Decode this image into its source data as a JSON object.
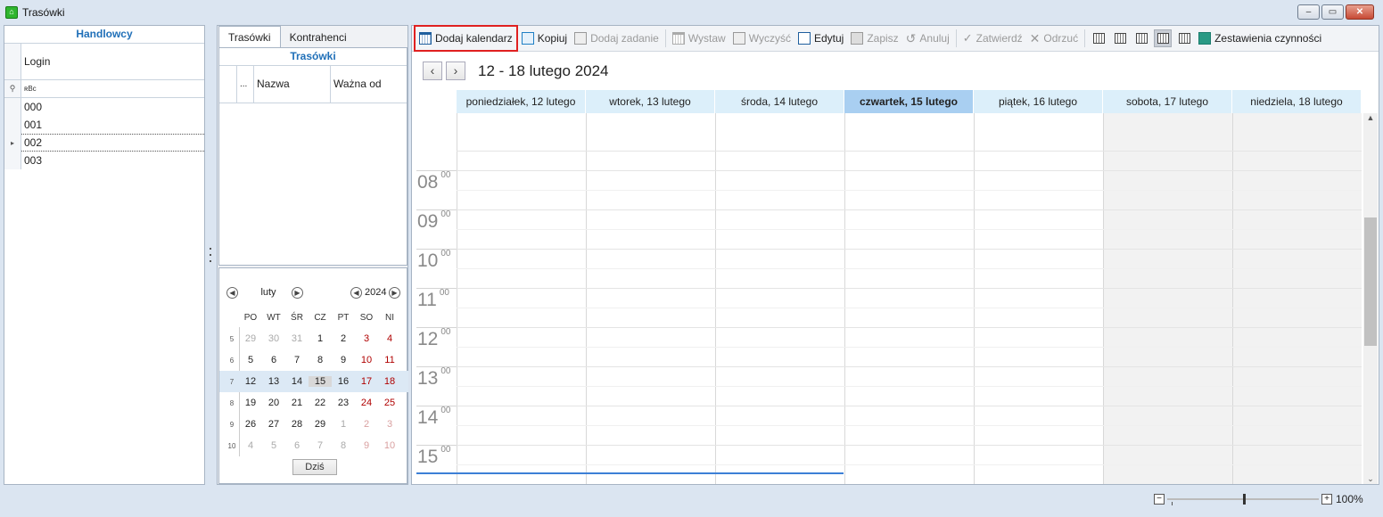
{
  "window": {
    "title": "Trasówki",
    "minimize": "‒",
    "maximize": "▭",
    "close": "✕"
  },
  "left": {
    "header": "Handlowcy",
    "column_login": "Login",
    "filter_abc": "ʀBc",
    "rows": [
      "000",
      "001",
      "002",
      "003"
    ],
    "selected_row": "002"
  },
  "middle": {
    "tabs": [
      "Trasówki",
      "Kontrahenci"
    ],
    "trasowki_header": "Trasówki",
    "columns": [
      "...",
      "Nazwa",
      "Ważna od"
    ],
    "calendar": {
      "month": "luty",
      "year": "2024",
      "weekday_heads": [
        "PO",
        "WT",
        "ŚR",
        "CZ",
        "PT",
        "SO",
        "NI"
      ],
      "weeks": [
        {
          "no": "5",
          "days": [
            "29",
            "30",
            "31",
            "1",
            "2",
            "3",
            "4"
          ]
        },
        {
          "no": "6",
          "days": [
            "5",
            "6",
            "7",
            "8",
            "9",
            "10",
            "11"
          ]
        },
        {
          "no": "7",
          "days": [
            "12",
            "13",
            "14",
            "15",
            "16",
            "17",
            "18"
          ]
        },
        {
          "no": "8",
          "days": [
            "19",
            "20",
            "21",
            "22",
            "23",
            "24",
            "25"
          ]
        },
        {
          "no": "9",
          "days": [
            "26",
            "27",
            "28",
            "29",
            "1",
            "2",
            "3"
          ]
        },
        {
          "no": "10",
          "days": [
            "4",
            "5",
            "6",
            "7",
            "8",
            "9",
            "10"
          ]
        }
      ],
      "today_button": "Dziś"
    }
  },
  "toolbar": {
    "dodaj_kalendarz": "Dodaj kalendarz",
    "kopiuj": "Kopiuj",
    "dodaj_zadanie": "Dodaj zadanie",
    "wystaw": "Wystaw",
    "wyczysc": "Wyczyść",
    "edytuj": "Edytuj",
    "zapisz": "Zapisz",
    "anuluj": "Anuluj",
    "zatwierdz": "Zatwierdź",
    "odrzuc": "Odrzuć",
    "zestawienia": "Zestawienia czynności"
  },
  "scheduler": {
    "range": "12 - 18 lutego 2024",
    "prev": "‹",
    "next": "›",
    "days": [
      "poniedziałek, 12 lutego",
      "wtorek, 13 lutego",
      "środa, 14 lutego",
      "czwartek, 15 lutego",
      "piątek, 16 lutego",
      "sobota, 17 lutego",
      "niedziela, 18 lutego"
    ],
    "today_day": "czwartek, 15 lutego",
    "hours": [
      "08",
      "09",
      "10",
      "11",
      "12",
      "13",
      "14",
      "15"
    ],
    "minutes": "00"
  },
  "zoom": {
    "minus": "−",
    "plus": "+",
    "value": "100%",
    "level_percent": 100
  }
}
